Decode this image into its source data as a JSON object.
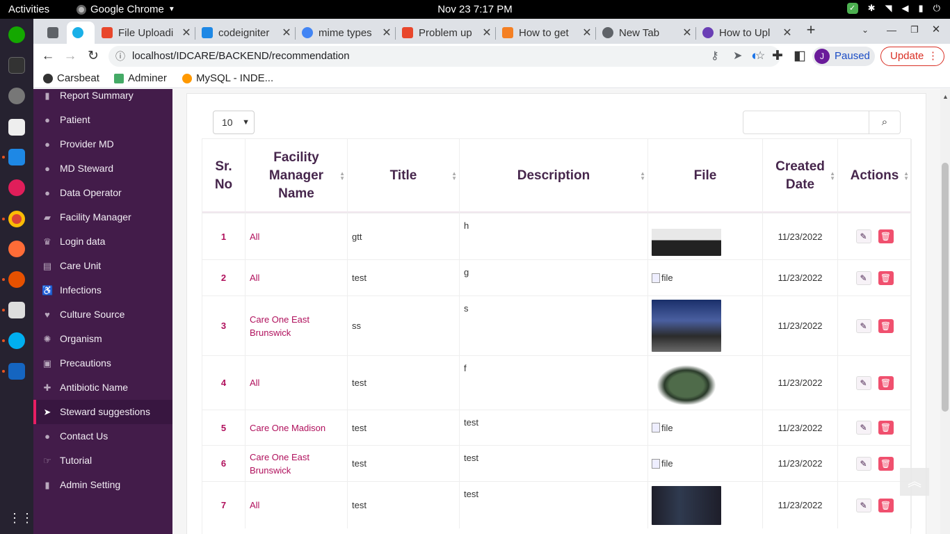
{
  "topbar": {
    "activities": "Activities",
    "app": "Google Chrome",
    "clock": "Nov 23  7:17 PM"
  },
  "tabs": [
    {
      "title": "File Uploadi",
      "color": "#e8472c"
    },
    {
      "title": "codeigniter",
      "color": "#1e88e5"
    },
    {
      "title": "mime types",
      "color": "#4285f4"
    },
    {
      "title": "Problem up",
      "color": "#e8472c"
    },
    {
      "title": "How to get",
      "color": "#f48024"
    },
    {
      "title": "New Tab",
      "color": "#5f6368"
    },
    {
      "title": "How to Upl",
      "color": "#6a3fb5"
    }
  ],
  "address": {
    "url": "localhost/IDCARE/BACKEND/recommendation",
    "paused": "Paused",
    "avatar": "J",
    "update": "Update"
  },
  "bookmarks": [
    "Carsbeat",
    "Adminer",
    "MySQL - INDE..."
  ],
  "sidebar": {
    "items": [
      {
        "label": "Report Summary",
        "icon": "bar-chart-icon"
      },
      {
        "label": "Patient",
        "icon": "user-icon"
      },
      {
        "label": "Provider MD",
        "icon": "user-md-icon"
      },
      {
        "label": "MD Steward",
        "icon": "user-icon"
      },
      {
        "label": "Data Operator",
        "icon": "user-icon"
      },
      {
        "label": "Facility Manager",
        "icon": "briefcase-icon"
      },
      {
        "label": "Login data",
        "icon": "trophy-icon"
      },
      {
        "label": "Care Unit",
        "icon": "hospital-icon"
      },
      {
        "label": "Infections",
        "icon": "wheelchair-icon"
      },
      {
        "label": "Culture Source",
        "icon": "heartbeat-icon"
      },
      {
        "label": "Organism",
        "icon": "bug-icon"
      },
      {
        "label": "Precautions",
        "icon": "h-square-icon"
      },
      {
        "label": "Antibiotic Name",
        "icon": "medkit-icon"
      },
      {
        "label": "Steward suggestions",
        "icon": "paper-plane-icon"
      },
      {
        "label": "Contact Us",
        "icon": "comment-icon"
      },
      {
        "label": "Tutorial",
        "icon": "hand-icon"
      },
      {
        "label": "Admin Setting",
        "icon": "bar-chart-icon"
      }
    ],
    "active": "Steward suggestions"
  },
  "table": {
    "length": "10",
    "headers": {
      "no": [
        "Sr.",
        "No"
      ],
      "fm": [
        "Facility",
        "Manager",
        "Name"
      ],
      "title": [
        "Title"
      ],
      "desc": [
        "Description"
      ],
      "file": [
        "File"
      ],
      "date": [
        "Created",
        "Date"
      ],
      "actions": [
        "Actions"
      ]
    },
    "rows": [
      {
        "no": "1",
        "fm": "All",
        "title": "gtt",
        "desc": "h",
        "file": "image",
        "date": "11/23/2022"
      },
      {
        "no": "2",
        "fm": "All",
        "title": "test",
        "desc": "g",
        "file": "file",
        "date": "11/23/2022"
      },
      {
        "no": "3",
        "fm": "Care One East Brunswick",
        "title": "ss",
        "desc": "s",
        "file": "image",
        "date": "11/23/2022"
      },
      {
        "no": "4",
        "fm": "All",
        "title": "test",
        "desc": "f",
        "file": "image",
        "date": "11/23/2022"
      },
      {
        "no": "5",
        "fm": "Care One Madison",
        "title": "test",
        "desc": "test",
        "file": "file",
        "date": "11/23/2022"
      },
      {
        "no": "6",
        "fm": "Care One East Brunswick",
        "title": "test",
        "desc": "test",
        "file": "file",
        "date": "11/23/2022"
      },
      {
        "no": "7",
        "fm": "All",
        "title": "test",
        "desc": "test",
        "file": "image",
        "date": "11/23/2022"
      }
    ]
  },
  "colors": {
    "sidebar": "#431c4a",
    "accent": "#b0105c",
    "delete": "#f0506e"
  }
}
